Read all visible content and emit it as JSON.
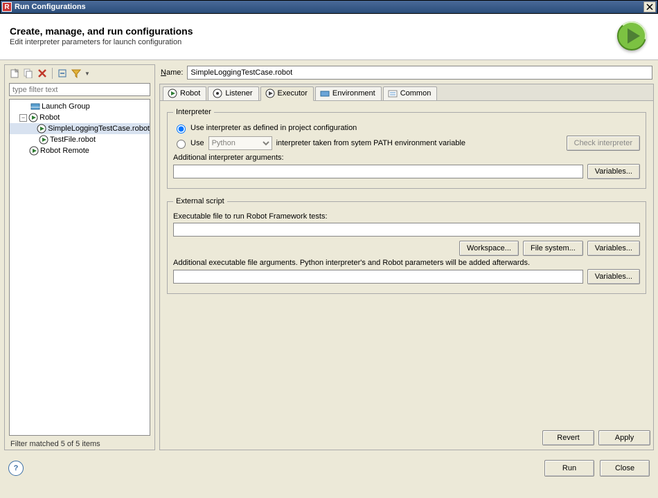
{
  "window": {
    "title": "Run Configurations",
    "icon_letter": "R"
  },
  "header": {
    "title": "Create, manage, and run configurations",
    "subtitle": "Edit interpreter parameters for launch configuration"
  },
  "left": {
    "filter_placeholder": "type filter text",
    "nodes": {
      "launch_group": "Launch Group",
      "robot": "Robot",
      "robot_children": [
        "SimpleLoggingTestCase.robot",
        "TestFile.robot"
      ],
      "robot_remote": "Robot Remote"
    },
    "status": "Filter matched 5 of 5 items"
  },
  "name_row": {
    "label": "Name:",
    "value": "SimpleLoggingTestCase.robot"
  },
  "tabs": {
    "robot": "Robot",
    "listener": "Listener",
    "executor": "Executor",
    "environment": "Environment",
    "common": "Common"
  },
  "interpreter": {
    "legend": "Interpreter",
    "opt_project": "Use interpreter as defined in project configuration",
    "opt_use": "Use",
    "interpreter_combo": "Python",
    "opt_use_tail": "interpreter taken from sytem PATH environment variable",
    "check_btn": "Check interpreter",
    "additional_args_label": "Additional interpreter arguments:",
    "variables_btn": "Variables..."
  },
  "external": {
    "legend": "External script",
    "exec_label": "Executable file to run Robot Framework tests:",
    "workspace_btn": "Workspace...",
    "filesystem_btn": "File system...",
    "variables_btn": "Variables...",
    "additional_exec_args_label": "Additional executable file arguments. Python interpreter's and Robot parameters will be added afterwards.",
    "variables_btn2": "Variables..."
  },
  "bottom": {
    "revert": "Revert",
    "apply": "Apply"
  },
  "footer": {
    "run": "Run",
    "close": "Close"
  }
}
